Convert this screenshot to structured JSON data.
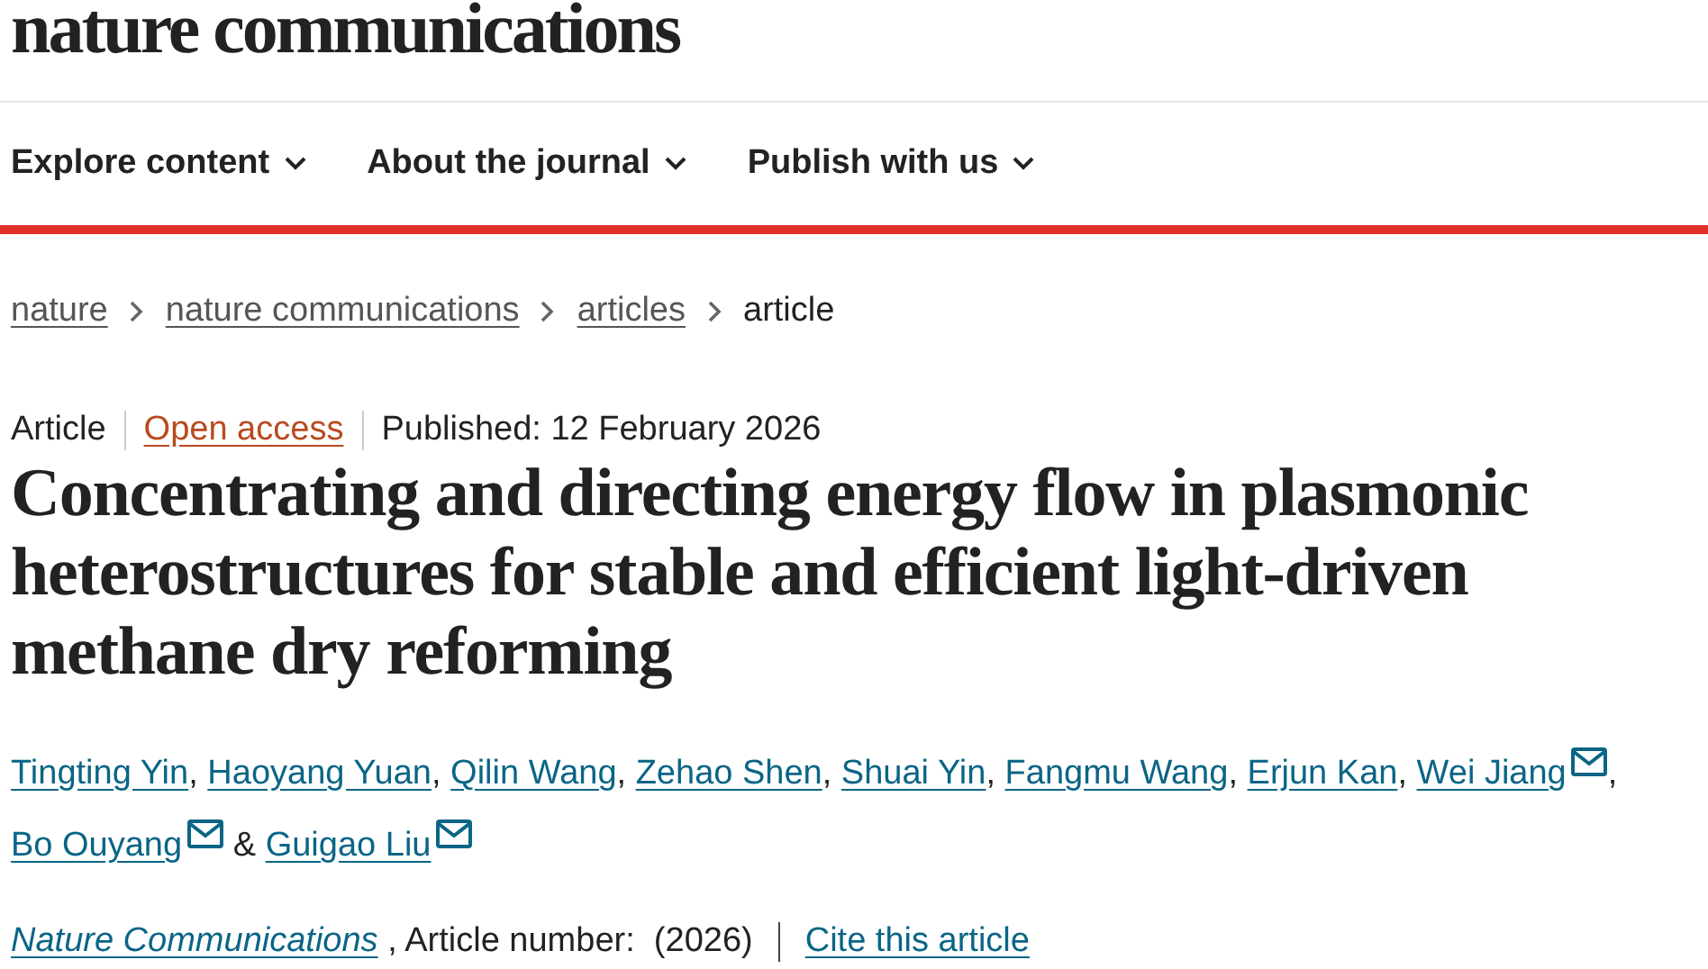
{
  "logo": "nature communications",
  "nav": [
    {
      "label": "Explore content"
    },
    {
      "label": "About the journal"
    },
    {
      "label": "Publish with us"
    }
  ],
  "breadcrumbs": [
    {
      "label": "nature",
      "link": true
    },
    {
      "label": "nature communications",
      "link": true
    },
    {
      "label": "articles",
      "link": true
    },
    {
      "label": "article",
      "link": false
    }
  ],
  "meta": {
    "type": "Article",
    "access": "Open access",
    "published": "Published: 12 February 2026"
  },
  "title": "Concentrating and directing energy flow in plasmonic heterostructures for stable and efficient light-driven methane dry reforming",
  "authors": [
    {
      "name": "Tingting Yin",
      "email": false,
      "sep": ","
    },
    {
      "name": "Haoyang Yuan",
      "email": false,
      "sep": ","
    },
    {
      "name": "Qilin Wang",
      "email": false,
      "sep": ","
    },
    {
      "name": "Zehao Shen",
      "email": false,
      "sep": ","
    },
    {
      "name": "Shuai Yin",
      "email": false,
      "sep": ","
    },
    {
      "name": "Fangmu Wang",
      "email": false,
      "sep": ","
    },
    {
      "name": "Erjun Kan",
      "email": false,
      "sep": ","
    },
    {
      "name": "Wei Jiang",
      "email": true,
      "sep": ","
    },
    {
      "name": "Bo Ouyang",
      "email": true,
      "sep": "&"
    },
    {
      "name": "Guigao Liu",
      "email": true
    }
  ],
  "citation": {
    "journal": "Nature Communications",
    "details": ", Article number:  (2026)",
    "cite": "Cite this article"
  }
}
